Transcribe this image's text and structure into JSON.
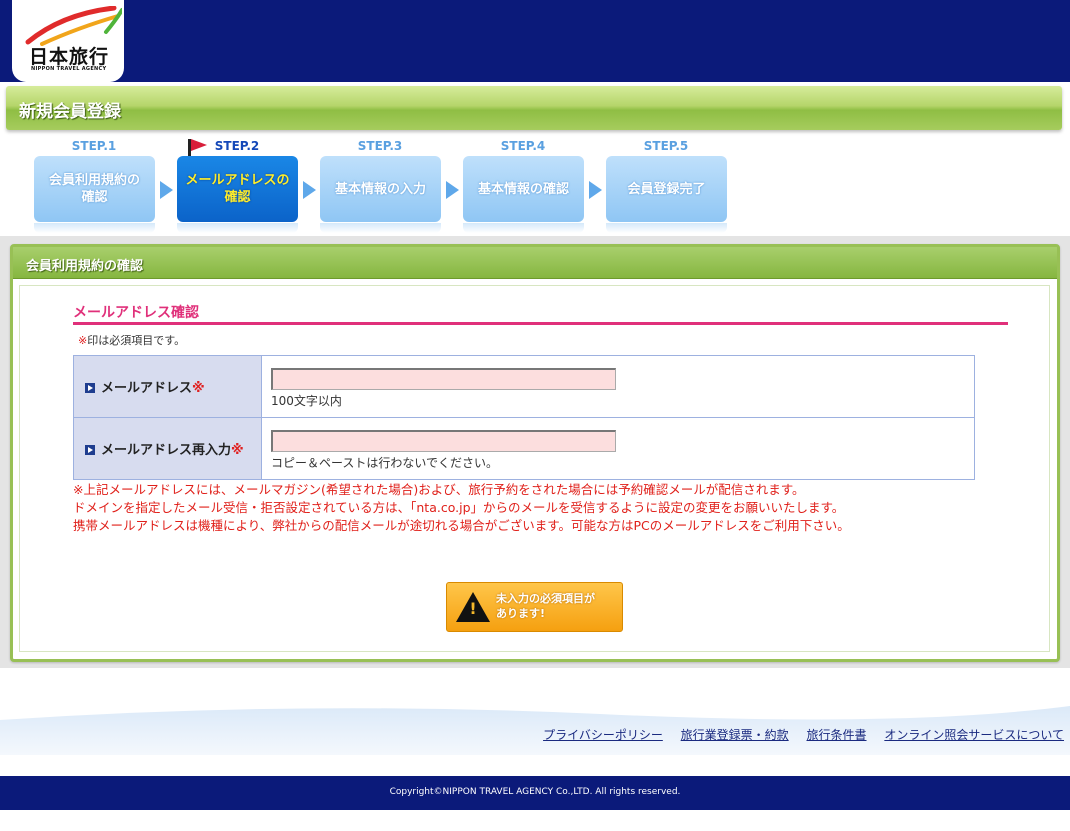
{
  "header": {
    "logo_text": "日本旅行",
    "logo_sub": "NIPPON TRAVEL AGENCY"
  },
  "page_title": "新規会員登録",
  "steps": [
    {
      "label": "STEP.1",
      "text_line1": "会員利用規約の",
      "text_line2": "確認",
      "active": false
    },
    {
      "label": "STEP.2",
      "text_line1": "メールアドレスの",
      "text_line2": "確認",
      "active": true
    },
    {
      "label": "STEP.3",
      "text_line1": "基本情報の入力",
      "text_line2": "",
      "active": false
    },
    {
      "label": "STEP.4",
      "text_line1": "基本情報の確認",
      "text_line2": "",
      "active": false
    },
    {
      "label": "STEP.5",
      "text_line1": "会員登録完了",
      "text_line2": "",
      "active": false
    }
  ],
  "panel": {
    "header": "会員利用規約の確認",
    "section_title": "メールアドレス確認",
    "required_note_mark": "※",
    "required_note_text": "印は必須項目です。"
  },
  "form": {
    "email": {
      "label": "メールアドレス",
      "required_mark": "※",
      "value": "",
      "hint": "100文字以内"
    },
    "email_confirm": {
      "label": "メールアドレス再入力",
      "required_mark": "※",
      "value": "",
      "hint": "コピー＆ペーストは行わないでください。"
    }
  },
  "notice": {
    "line1": "※上記メールアドレスには、メールマガジン(希望された場合)および、旅行予約をされた場合には予約確認メールが配信されます。",
    "line2": "ドメインを指定したメール受信・拒否設定されている方は、「nta.co.jp」からのメールを受信するように設定の変更をお願いいたします。",
    "line3": "携帯メールアドレスは機種により、弊社からの配信メールが途切れる場合がございます。可能な方はPCのメールアドレスをご利用下さい。"
  },
  "warning_button": {
    "line1": "未入力の必須項目が",
    "line2": "あります!"
  },
  "footer": {
    "links": [
      "プライバシーポリシー",
      "旅行業登録票・約款",
      "旅行条件書",
      "オンライン照会サービスについて"
    ],
    "copyright": "Copyright©NIPPON TRAVEL AGENCY Co.,LTD. All rights reserved."
  },
  "colors": {
    "header_navy": "#0b1a7a",
    "title_green": "#8fbe44",
    "step_active": "#0b63c9",
    "step_inactive": "#8fc6f4",
    "accent_pink": "#e0307a",
    "required_red": "#e02020",
    "warning_orange": "#f5a010"
  }
}
